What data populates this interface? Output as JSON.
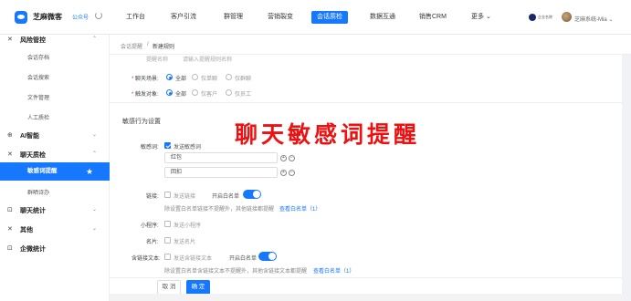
{
  "topbar": {
    "brand": "芝麻微客",
    "account_type": "公众号",
    "nav": [
      "工作台",
      "客户引流",
      "群管理",
      "营销裂变",
      "会话质检",
      "数据互通",
      "销售CRM",
      "更多 ⌄"
    ],
    "active_nav": "会话质检",
    "user_badge": "企业名称",
    "user_name": "芝麻系统-Mia ⌄"
  },
  "sidebar": {
    "items": [
      {
        "kind": "group",
        "icon": "✕",
        "label": "风险管控",
        "chevron": "⌃"
      },
      {
        "kind": "sub",
        "label": "会话存档"
      },
      {
        "kind": "sub",
        "label": "会话搜索"
      },
      {
        "kind": "sub",
        "label": "文件管理"
      },
      {
        "kind": "sub",
        "label": "人工质检"
      },
      {
        "kind": "group",
        "icon": "⊕",
        "label": "AI智能",
        "chevron": "⌄"
      },
      {
        "kind": "group",
        "icon": "✕",
        "label": "聊天质检",
        "chevron": "⌃"
      },
      {
        "kind": "active",
        "label": "敏感词提醒",
        "star": "★"
      },
      {
        "kind": "sub",
        "label": "群晒诗办"
      },
      {
        "kind": "group",
        "icon": "⊡",
        "label": "聊天统计",
        "chevron": "⌄"
      },
      {
        "kind": "group",
        "icon": "✕",
        "label": "其他",
        "chevron": "⌄"
      },
      {
        "kind": "group",
        "icon": "⊡",
        "label": "企微统计",
        "chevron": ""
      }
    ]
  },
  "breadcrumb": {
    "parent": "会话提醒",
    "separator": "/",
    "current": "新建规则"
  },
  "form": {
    "rule_name_label": "提醒名称",
    "rule_name_placeholder": "请输入提醒规则名称",
    "scene_label": "聊天场景:",
    "scene_options": [
      "全部",
      "仅单聊",
      "仅群聊"
    ],
    "target_label": "触发对象:",
    "target_options": [
      "全部",
      "仅客户",
      "仅员工"
    ],
    "section_title": "敏感行为设置",
    "sensitive_label": "敏感词:",
    "sensitive_check": "发送敏感词",
    "keywords": [
      "红包",
      "回扣"
    ],
    "link_label": "链接:",
    "link_check": "发送链接",
    "whitelist_label": "开启白名单",
    "link_hint": "除设置白名单链接不提醒外，其他链接都提醒",
    "link_whitelist": "查看白名单（1）",
    "miniprog_label": "小程序:",
    "miniprog_check": "发送小程序",
    "card_label": "名片:",
    "card_check": "发送名片",
    "linktext_label": "含链接文本:",
    "linktext_check": "发送含链接文本",
    "linktext_whitelist_label": "开启白名单",
    "linktext_hint": "除设置白名单含链接文本不提醒外，其他含链接文本都提醒",
    "linktext_whitelist": "查看白名单（1）",
    "cancel": "取 消",
    "confirm": "确 定"
  },
  "overlay_title": "聊天敏感词提醒",
  "colors": {
    "accent": "#1677ff",
    "overlay": "#e11111"
  }
}
